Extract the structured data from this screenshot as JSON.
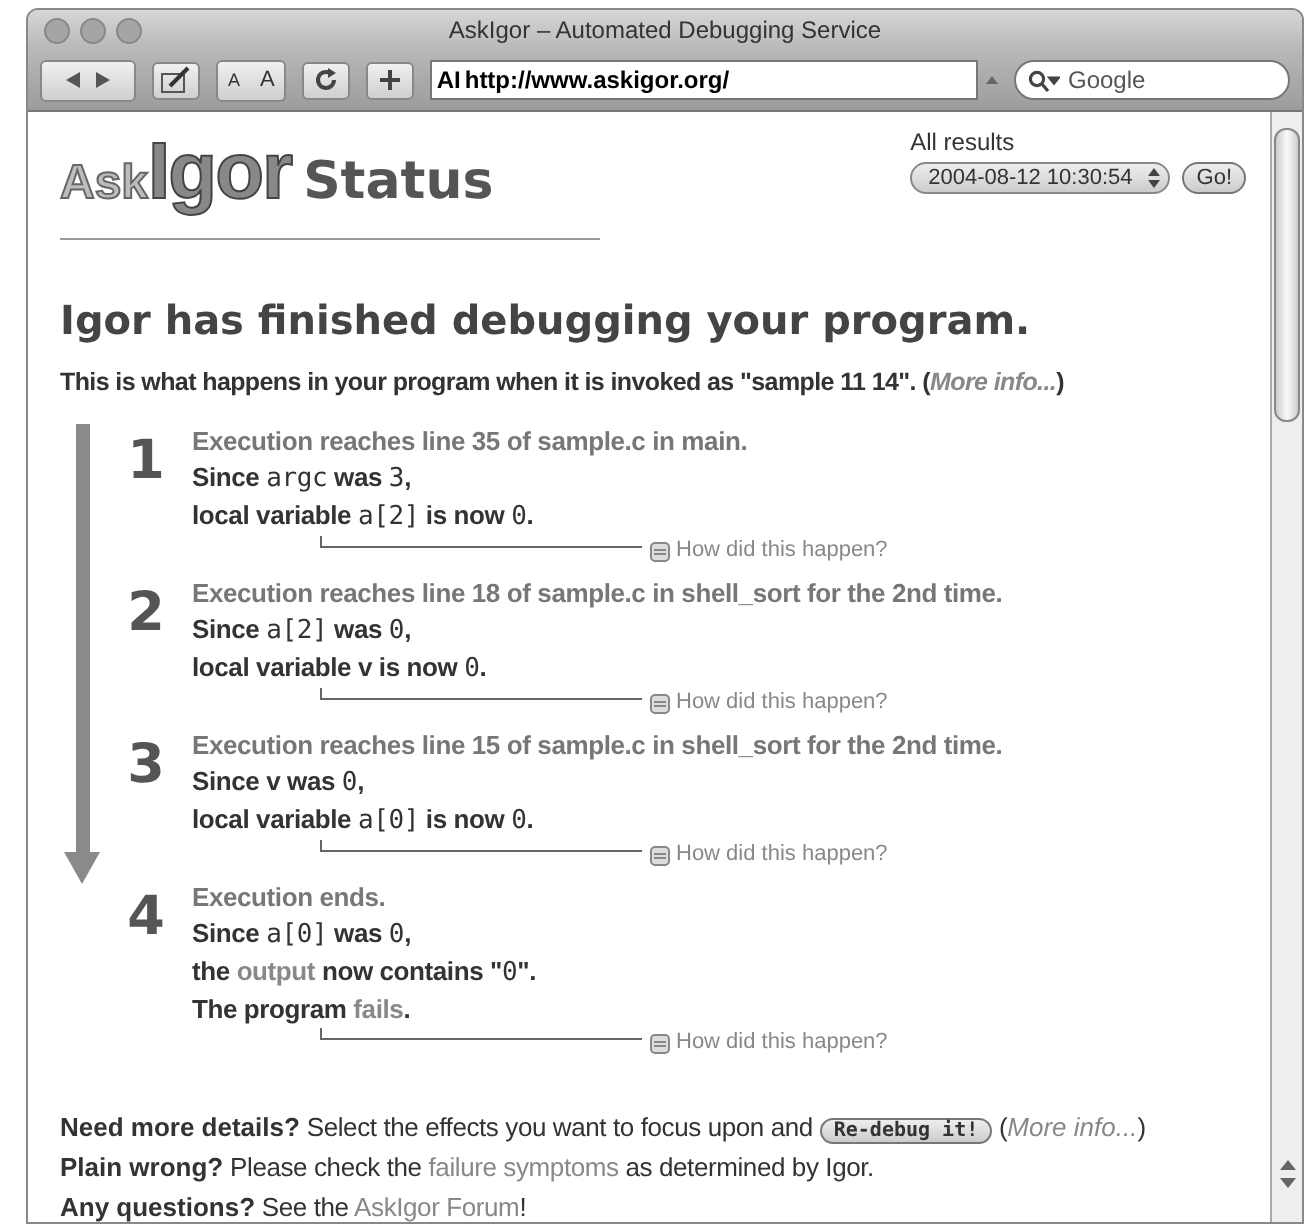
{
  "window": {
    "title": "AskIgor – Automated Debugging Service"
  },
  "toolbar": {
    "small_a": "A",
    "large_a": "A",
    "address": "http://www.askigor.org/",
    "address_prefix": "AI",
    "search_placeholder": "Google"
  },
  "header": {
    "logo_left": "Ask",
    "logo_main": "Igor",
    "title": "Status",
    "results_label": "All results",
    "results_select": "2004-08-12 10:30:54",
    "go_button": "Go!"
  },
  "heading": "Igor has finished debugging your program.",
  "intro": {
    "text": "This is what happens in your program when it is invoked as \"sample 11 14\". (",
    "more": "More info...",
    "close": ")"
  },
  "steps": [
    {
      "number": "1",
      "title": "Execution reaches line 35 of sample.c in main.",
      "lines": [
        [
          {
            "kind": "plain",
            "text": "Since "
          },
          {
            "kind": "code",
            "text": "argc"
          },
          {
            "kind": "plain",
            "text": " was "
          },
          {
            "kind": "code",
            "text": "3"
          },
          {
            "kind": "plain",
            "text": ","
          }
        ],
        [
          {
            "kind": "plain",
            "text": "local variable "
          },
          {
            "kind": "code",
            "text": "a[2]"
          },
          {
            "kind": "plain",
            "text": " is now "
          },
          {
            "kind": "code",
            "text": "0"
          },
          {
            "kind": "plain",
            "text": "."
          }
        ]
      ],
      "how": "How did this happen?"
    },
    {
      "number": "2",
      "title": "Execution reaches line 18 of sample.c in shell_sort for the 2nd time.",
      "lines": [
        [
          {
            "kind": "plain",
            "text": "Since "
          },
          {
            "kind": "code",
            "text": "a[2]"
          },
          {
            "kind": "plain",
            "text": " was "
          },
          {
            "kind": "code",
            "text": "0"
          },
          {
            "kind": "plain",
            "text": ","
          }
        ],
        [
          {
            "kind": "plain",
            "text": "local variable v is now "
          },
          {
            "kind": "code",
            "text": "0"
          },
          {
            "kind": "plain",
            "text": "."
          }
        ]
      ],
      "how": "How did this happen?"
    },
    {
      "number": "3",
      "title": "Execution reaches line 15 of sample.c in shell_sort for the 2nd time.",
      "lines": [
        [
          {
            "kind": "plain",
            "text": "Since v was "
          },
          {
            "kind": "code",
            "text": "0"
          },
          {
            "kind": "plain",
            "text": ","
          }
        ],
        [
          {
            "kind": "plain",
            "text": "local variable "
          },
          {
            "kind": "code",
            "text": "a[0]"
          },
          {
            "kind": "plain",
            "text": " is now "
          },
          {
            "kind": "code",
            "text": "0"
          },
          {
            "kind": "plain",
            "text": "."
          }
        ]
      ],
      "how": "How did this happen?"
    },
    {
      "number": "4",
      "title": "Execution ends.",
      "lines": [
        [
          {
            "kind": "plain",
            "text": "Since "
          },
          {
            "kind": "code",
            "text": "a[0]"
          },
          {
            "kind": "plain",
            "text": " was "
          },
          {
            "kind": "code",
            "text": "0"
          },
          {
            "kind": "plain",
            "text": ","
          }
        ],
        [
          {
            "kind": "plain",
            "text": "the "
          },
          {
            "kind": "link",
            "text": "output"
          },
          {
            "kind": "plain",
            "text": " now contains \""
          },
          {
            "kind": "code",
            "text": "0"
          },
          {
            "kind": "plain",
            "text": "\"."
          }
        ],
        [
          {
            "kind": "plain",
            "text": "The program "
          },
          {
            "kind": "link",
            "text": "fails"
          },
          {
            "kind": "plain",
            "text": "."
          }
        ]
      ],
      "how": "How did this happen?"
    }
  ],
  "footer": [
    [
      {
        "kind": "bold",
        "text": "Need more details?"
      },
      {
        "kind": "plain",
        "text": " Select the effects you want to focus upon and "
      },
      {
        "kind": "button",
        "text": "Re-debug it!"
      },
      {
        "kind": "plain",
        "text": " ("
      },
      {
        "kind": "more",
        "text": "More info..."
      },
      {
        "kind": "plain",
        "text": ")"
      }
    ],
    [
      {
        "kind": "bold",
        "text": "Plain wrong?"
      },
      {
        "kind": "plain",
        "text": " Please check the "
      },
      {
        "kind": "link",
        "text": "failure symptoms"
      },
      {
        "kind": "plain",
        "text": " as determined by Igor."
      }
    ],
    [
      {
        "kind": "bold",
        "text": "Any questions?"
      },
      {
        "kind": "plain",
        "text": " See the "
      },
      {
        "kind": "link",
        "text": "AskIgor Forum"
      },
      {
        "kind": "plain",
        "text": "!"
      }
    ]
  ]
}
